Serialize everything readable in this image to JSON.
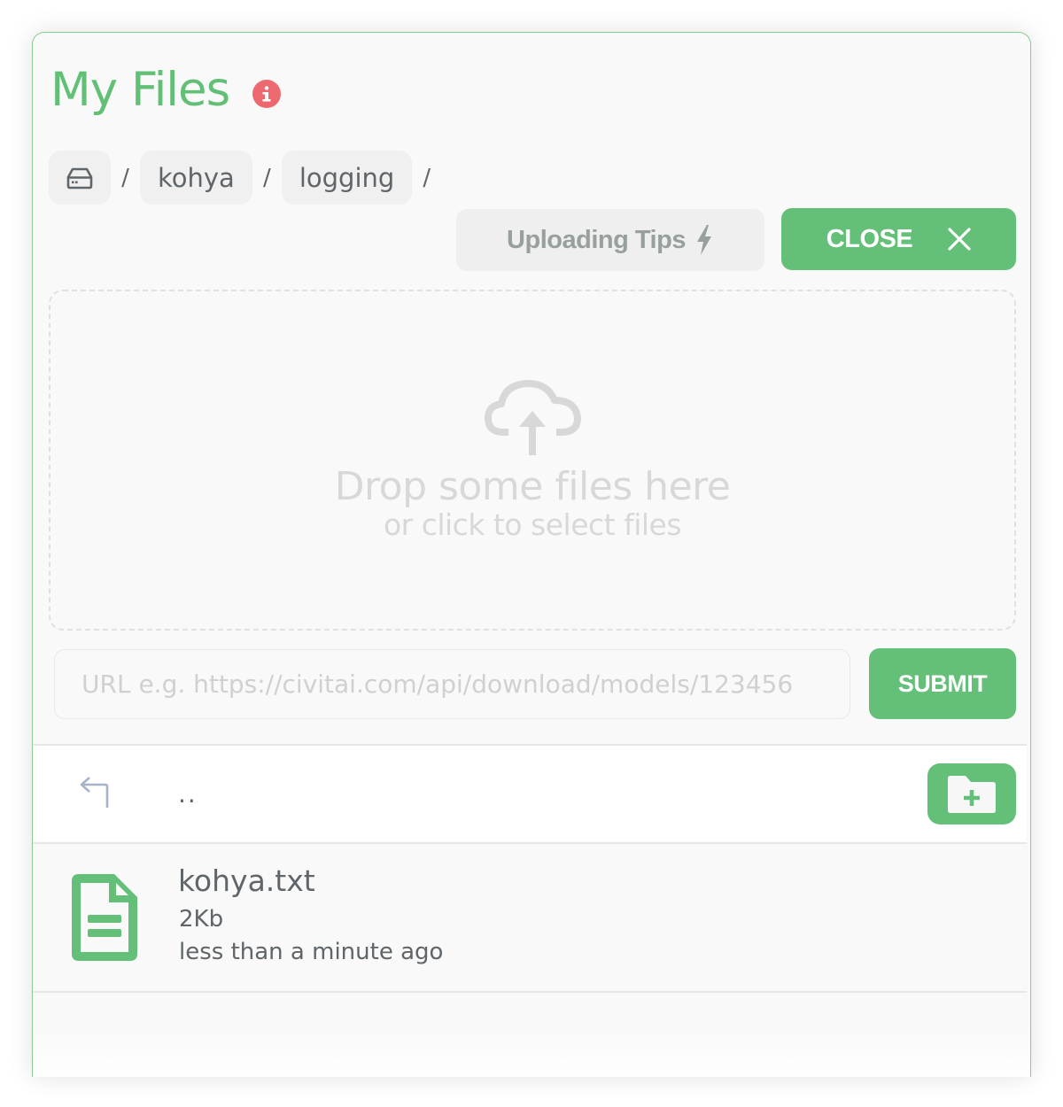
{
  "header": {
    "title": "My Files",
    "info_icon": "info-circle-icon"
  },
  "breadcrumb": {
    "root_icon": "hard-drive-icon",
    "separator": "/",
    "items": [
      {
        "label": "kohya"
      },
      {
        "label": "logging"
      }
    ]
  },
  "actions": {
    "tips_label": "Uploading Tips",
    "tips_icon": "lightning-bolt-icon",
    "close_label": "CLOSE",
    "close_icon": "close-x-icon"
  },
  "dropzone": {
    "icon": "cloud-upload-icon",
    "main_text": "Drop some files here",
    "sub_text": "or click to select files"
  },
  "url_form": {
    "value": "",
    "placeholder": "URL e.g. https://civitai.com/api/download/models/123456",
    "submit_label": "SUBMIT"
  },
  "file_list": {
    "parent_row": {
      "icon": "return-up-arrow-icon",
      "label": ".."
    },
    "new_folder_icon": "folder-plus-icon",
    "files": [
      {
        "icon": "text-file-icon",
        "name": "kohya.txt",
        "size": "2Kb",
        "modified": "less than a minute ago"
      }
    ]
  },
  "colors": {
    "accent": "#64c078",
    "title": "#62bf76",
    "info": "#ec6a6f",
    "text_muted": "#5f6568"
  }
}
